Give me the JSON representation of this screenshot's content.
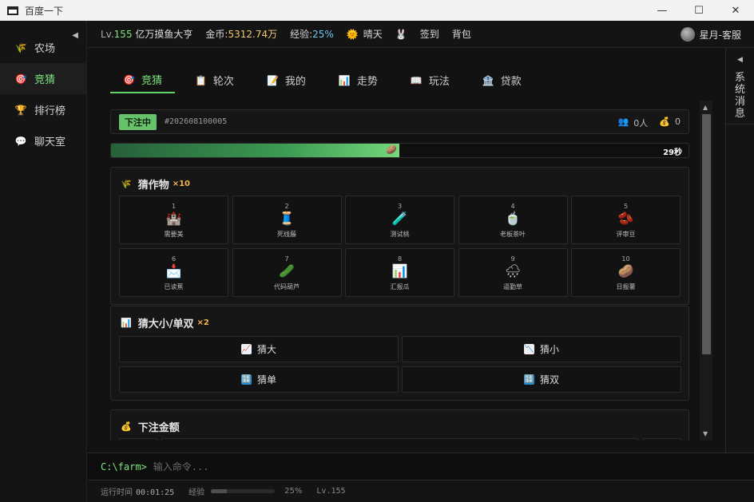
{
  "window": {
    "title": "百度一下",
    "minimize": "—",
    "maximize": "☐",
    "close": "✕"
  },
  "sidebar": {
    "collapse_icon": "◀",
    "items": [
      {
        "label": "农场",
        "icon": "🌾"
      },
      {
        "label": "竞猜",
        "icon": "🎯"
      },
      {
        "label": "排行榜",
        "icon": "🏆"
      },
      {
        "label": "聊天室",
        "icon": "💬"
      }
    ]
  },
  "status": {
    "level_prefix": "Lv.",
    "level": "155",
    "nickname": "亿万摸鱼大亨",
    "coin_label": "金币:",
    "coin_value": "5312.74万",
    "exp_label": "经验:",
    "exp_value": "25%",
    "weather_icon": "🌞",
    "weather": "晴天",
    "rabbit_icon": "🐰",
    "checkin": "签到",
    "bag": "背包",
    "user": "星月-客服"
  },
  "right_panel": {
    "arrow": "◀",
    "label": "系统消息"
  },
  "tabs": [
    {
      "label": "竞猜",
      "icon": "🎯"
    },
    {
      "label": "轮次",
      "icon": "📋"
    },
    {
      "label": "我的",
      "icon": "📝"
    },
    {
      "label": "走势",
      "icon": "📊"
    },
    {
      "label": "玩法",
      "icon": "📖"
    },
    {
      "label": "贷款",
      "icon": "🏦"
    }
  ],
  "round": {
    "status": "下注中",
    "number": "#202608100005",
    "people_icon": "👥",
    "people": "0人",
    "bag_icon": "💰",
    "pool": "0",
    "progress": 0.5,
    "marker_icon": "🥔",
    "countdown": "29秒"
  },
  "crops_section": {
    "icon": "🌾",
    "title": "猜作物",
    "multiplier": "×10",
    "items": [
      {
        "num": "1",
        "icon": "🏰",
        "name": "需要美"
      },
      {
        "num": "2",
        "icon": "🧵",
        "name": "死线藤"
      },
      {
        "num": "3",
        "icon": "🧪",
        "name": "测试桃"
      },
      {
        "num": "4",
        "icon": "🍵",
        "name": "老板茶叶"
      },
      {
        "num": "5",
        "icon": "🫘",
        "name": "评审豆"
      },
      {
        "num": "6",
        "icon": "📩",
        "name": "已读蕉"
      },
      {
        "num": "7",
        "icon": "🥒",
        "name": "代码葫芦"
      },
      {
        "num": "8",
        "icon": "📊",
        "name": "汇报瓜"
      },
      {
        "num": "9",
        "icon": "🌧",
        "name": "逼勤草"
      },
      {
        "num": "10",
        "icon": "🥔",
        "name": "日报薯"
      }
    ]
  },
  "size_section": {
    "icon": "📊",
    "title": "猜大小/单双",
    "multiplier": "×2",
    "bets": [
      {
        "label": "猜大",
        "icon": "📈"
      },
      {
        "label": "猜小",
        "icon": "📉"
      },
      {
        "label": "猜单",
        "icon": "🔢"
      },
      {
        "label": "猜双",
        "icon": "🔢"
      }
    ]
  },
  "amount_section": {
    "icon": "💰",
    "title": "下注金额"
  },
  "scroll": {
    "up": "▲",
    "down": "▼"
  },
  "cmd": {
    "prompt": "C:\\farm>",
    "placeholder": "输入命令..."
  },
  "footer": {
    "runtime_label": "运行时间",
    "runtime": "00:01:25",
    "exp_label": "经验",
    "exp_fraction": 0.25,
    "exp_percent": "25%",
    "level": "Lv.155"
  }
}
